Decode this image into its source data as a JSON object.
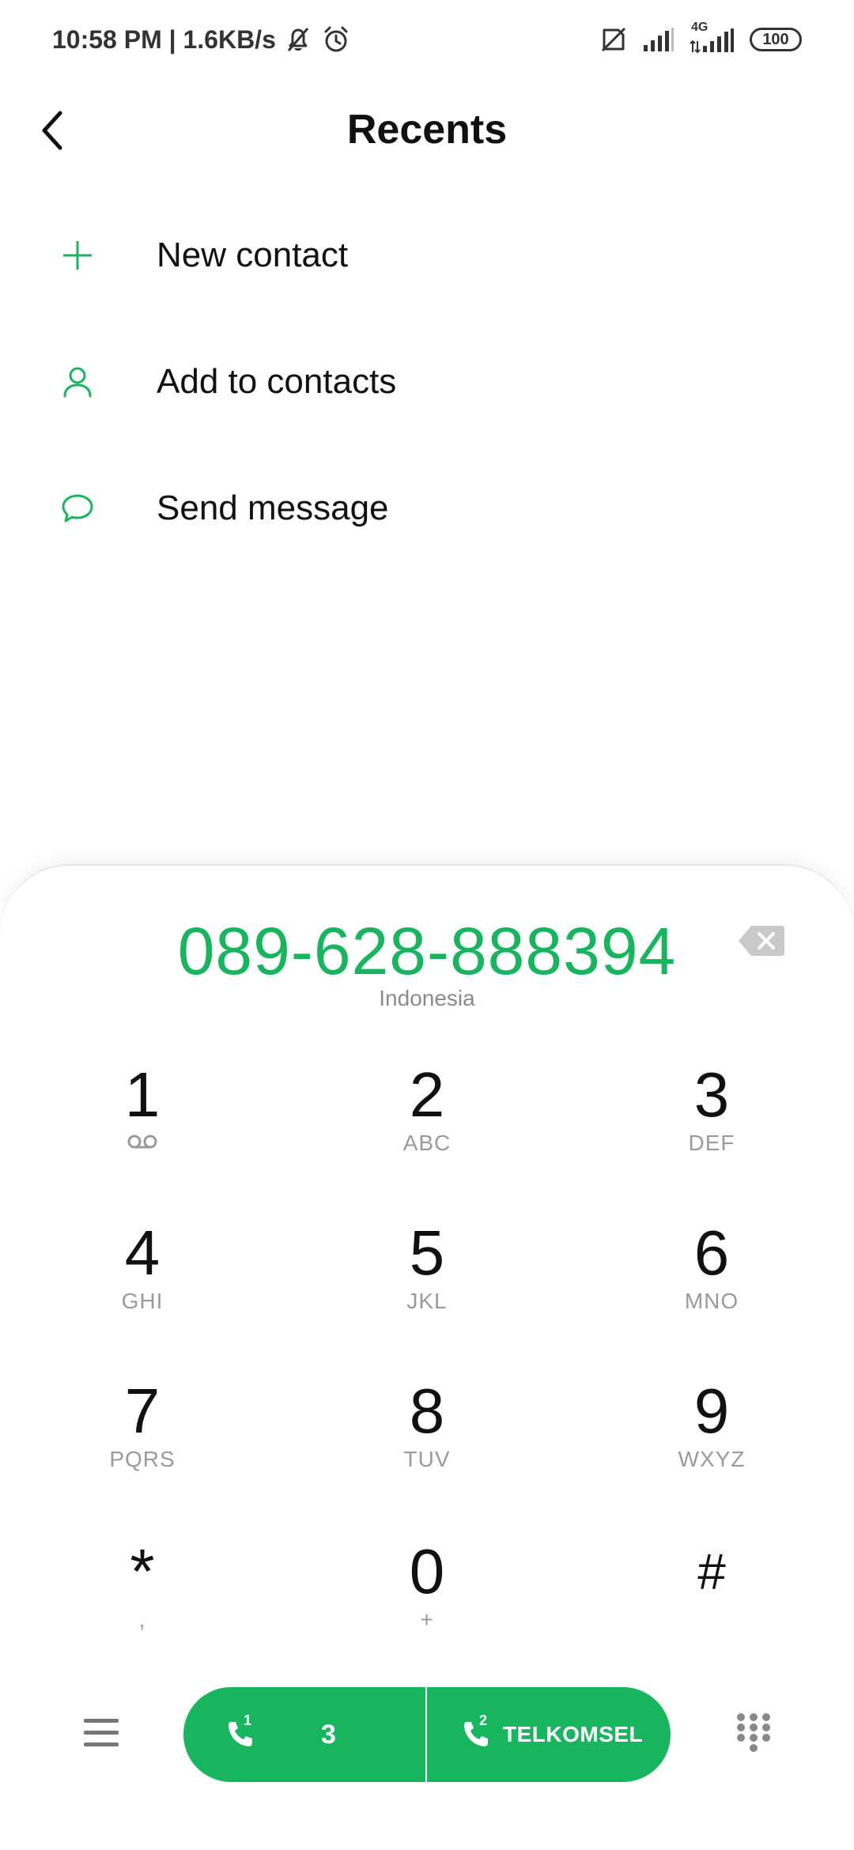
{
  "status_bar": {
    "time_speed": "10:58 PM | 1.6KB/s",
    "network_type": "4G",
    "battery": "100",
    "icons": [
      "bell-off-icon",
      "alarm-icon",
      "sim-off-icon",
      "signal-icon",
      "signal-4g-icon",
      "battery-icon"
    ]
  },
  "header": {
    "title": "Recents",
    "back_icon": "back-arrow-icon"
  },
  "actions": [
    {
      "label": "New contact",
      "icon": "plus-icon"
    },
    {
      "label": "Add to contacts",
      "icon": "person-icon"
    },
    {
      "label": "Send message",
      "icon": "chat-bubble-icon"
    }
  ],
  "dialer": {
    "number": "089-628-888394",
    "region": "Indonesia",
    "keys": [
      {
        "digit": "1",
        "letters": ""
      },
      {
        "digit": "2",
        "letters": "ABC"
      },
      {
        "digit": "3",
        "letters": "DEF"
      },
      {
        "digit": "4",
        "letters": "GHI"
      },
      {
        "digit": "5",
        "letters": "JKL"
      },
      {
        "digit": "6",
        "letters": "MNO"
      },
      {
        "digit": "7",
        "letters": "PQRS"
      },
      {
        "digit": "8",
        "letters": "TUV"
      },
      {
        "digit": "9",
        "letters": "WXYZ"
      },
      {
        "digit": "*",
        "letters": ","
      },
      {
        "digit": "0",
        "letters": "+"
      },
      {
        "digit": "#",
        "letters": ""
      }
    ]
  },
  "call_bar": {
    "sim1_index": "1",
    "sim1_label": "3",
    "sim2_index": "2",
    "sim2_label": "TELKOMSEL"
  },
  "colors": {
    "accent": "#17b65e",
    "text": "#111111",
    "muted": "#9a9a9a"
  }
}
